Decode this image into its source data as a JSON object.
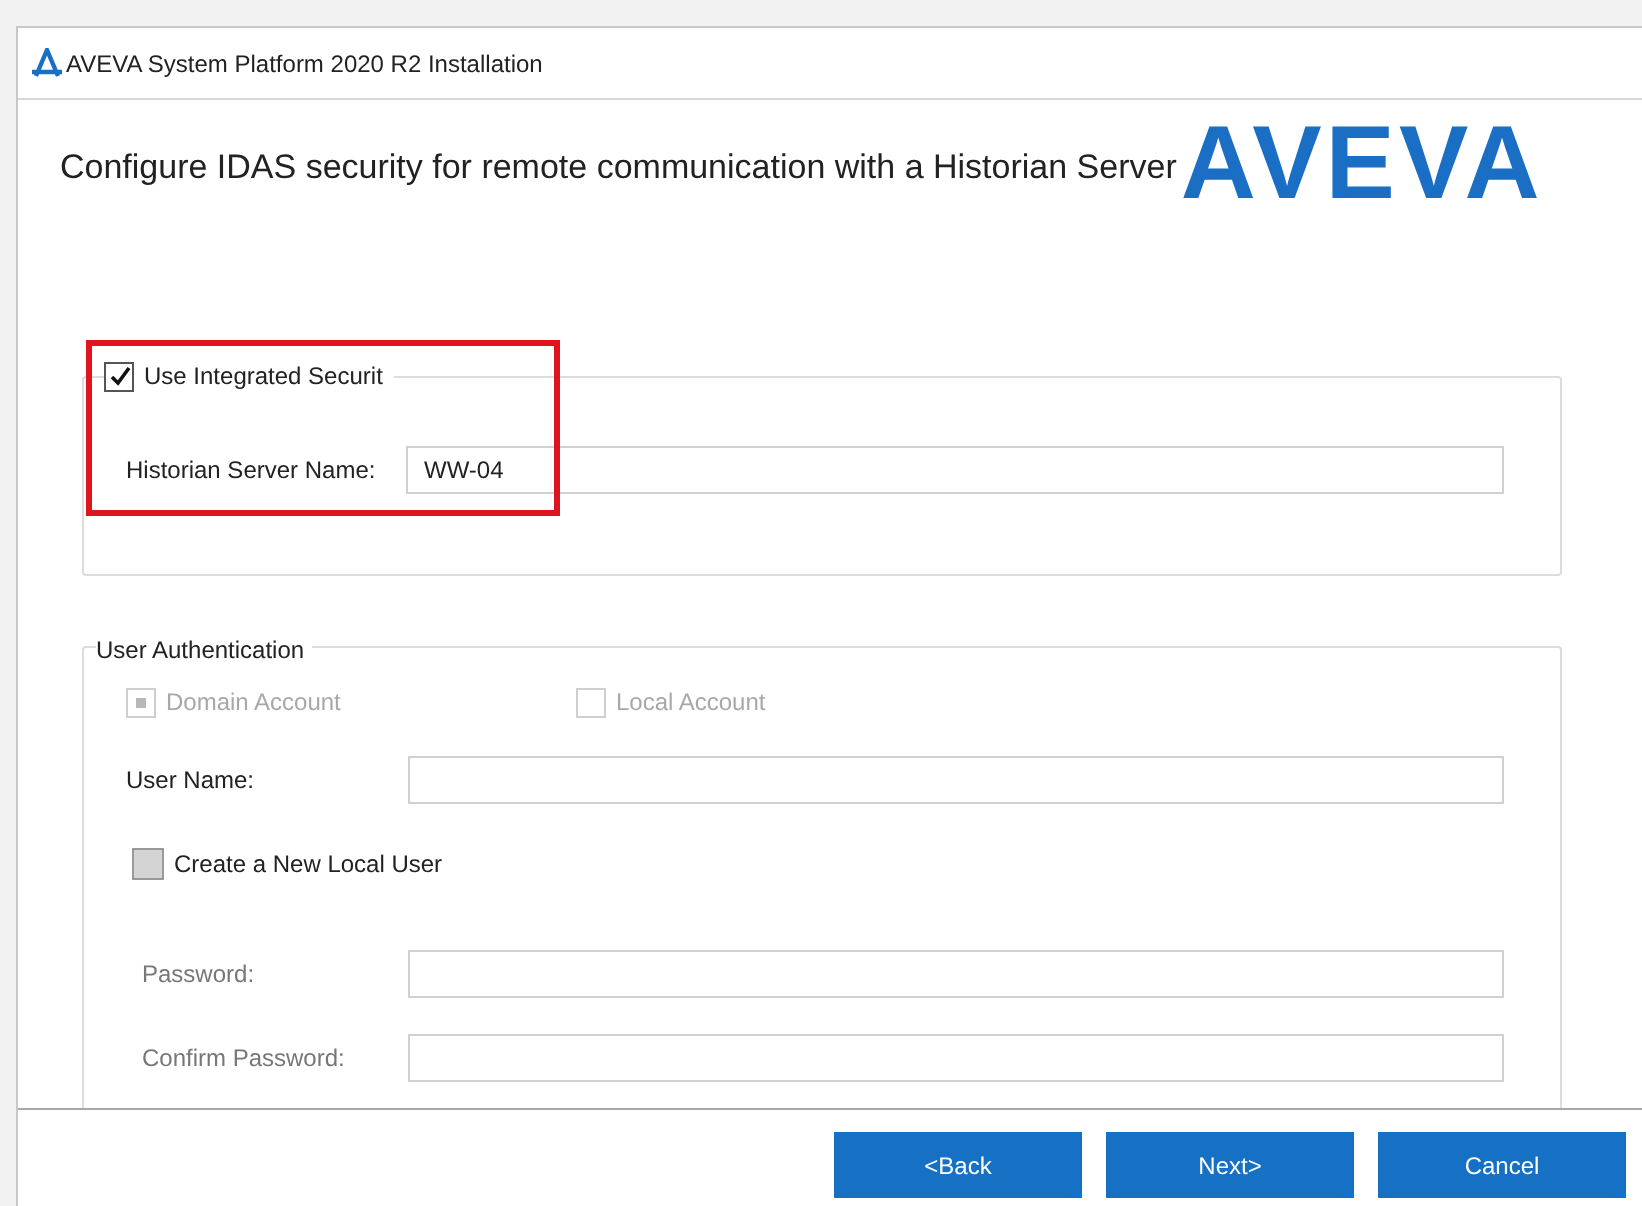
{
  "window": {
    "title": "AVEVA System Platform 2020 R2 Installation"
  },
  "header": {
    "heading": "Configure IDAS security for remote communication with a Historian Server",
    "logo": "AVEVA"
  },
  "integrated_security": {
    "label": "Use Integrated Securit",
    "checked": true,
    "server_label": "Historian Server Name:",
    "server_value": "WW-04",
    "highlighted": true
  },
  "user_authentication": {
    "legend": "User Authentication",
    "accounts": [
      {
        "label": "Domain Account",
        "checked": true,
        "disabled": true
      },
      {
        "label": "Local Account",
        "checked": false,
        "disabled": true
      }
    ],
    "user_name": {
      "label": "User Name:"
    },
    "create_local_user": {
      "label": "Create a New Local User",
      "checked": false
    },
    "password_fields": [
      {
        "label": "Password:",
        "disabled": true
      },
      {
        "label": "Confirm Password:",
        "disabled": true
      }
    ]
  },
  "buttons": [
    "<Back",
    "Next>",
    "Cancel"
  ]
}
